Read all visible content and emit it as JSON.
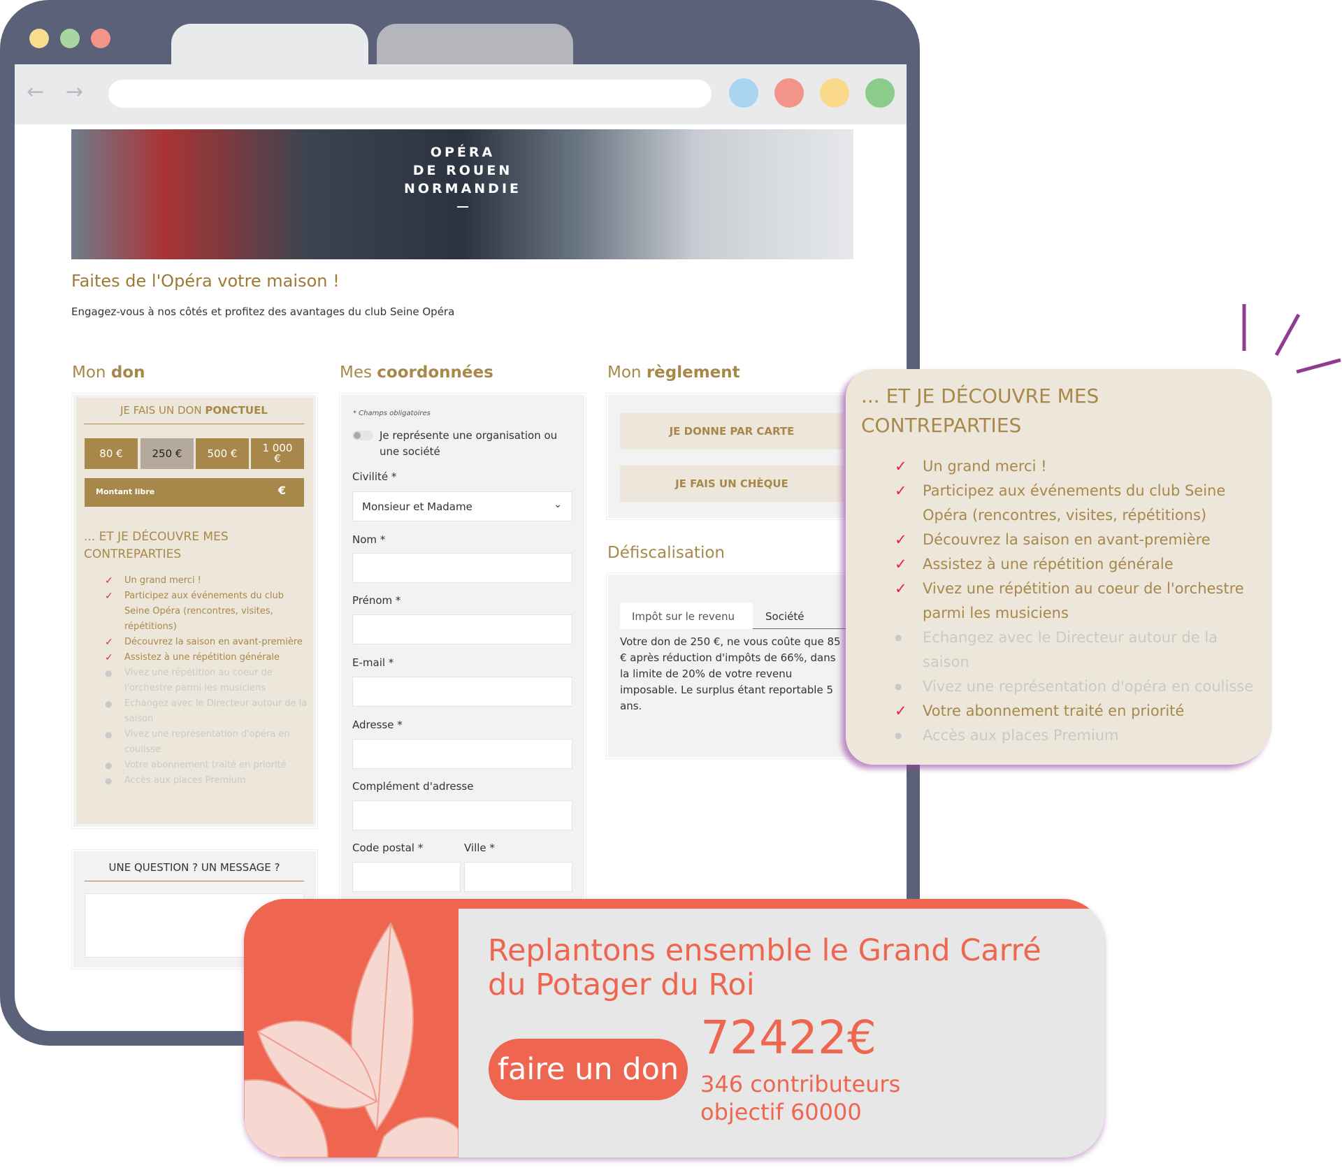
{
  "browser": {
    "back_icon": "arrow-left",
    "forward_icon": "arrow-right",
    "dots_colors": [
      "#a9d4f2",
      "#f2948a",
      "#fad98a",
      "#8ccc8a"
    ],
    "lights_colors": [
      "#f9dc8e",
      "#a7d6a1",
      "#f29488"
    ]
  },
  "banner": {
    "logo_lines": [
      "OPÉRA",
      "DE ROUEN",
      "NORMANDIE"
    ]
  },
  "page": {
    "title": "Faites de l'Opéra votre maison !",
    "subtitle": "Engagez-vous à nos côtés et profitez des avantages du club Seine Opéra"
  },
  "don": {
    "heading_light": "Mon",
    "heading_bold": "don",
    "panel_title_light": "JE FAIS UN DON",
    "panel_title_bold": "PONCTUEL",
    "amounts": [
      "80 €",
      "250 €",
      "500 €",
      "1 000 €"
    ],
    "selected_amount": "250 €",
    "free_amount_placeholder": "Montant libre",
    "free_amount_unit": "€",
    "benefits_title": "... ET JE DÉCOUVRE MES CONTREPARTIES",
    "benefits": [
      {
        "text": "Un grand merci !",
        "included": true
      },
      {
        "text": "Participez aux événements du club Seine Opéra (rencontres, visites, répétitions)",
        "included": true
      },
      {
        "text": "Découvrez la saison en avant-première",
        "included": true
      },
      {
        "text": "Assistez à une répétition générale",
        "included": true
      },
      {
        "text": "Vivez une répétition au coeur de l'orchestre parmi les musiciens",
        "included": false
      },
      {
        "text": "Echangez avec le Directeur autour de la saison",
        "included": false
      },
      {
        "text": "Vivez une représentation d'opéra en coulisse",
        "included": false
      },
      {
        "text": "Votre abonnement traité en priorité",
        "included": false
      },
      {
        "text": "Accès aux places Premium",
        "included": false
      }
    ]
  },
  "question": {
    "title": "UNE QUESTION ? UN MESSAGE ?",
    "value": ""
  },
  "coord": {
    "heading_light": "Mes",
    "heading_bold": "coordonnées",
    "required_note": "* Champs obligatoires",
    "org_toggle_label": "Je représente une organisation ou une société",
    "civilite_label": "Civilité *",
    "civilite_value": "Monsieur et Madame",
    "nom_label": "Nom *",
    "prenom_label": "Prénom *",
    "email_label": "E-mail *",
    "adresse_label": "Adresse *",
    "complement_label": "Complément d'adresse",
    "cp_label": "Code postal *",
    "ville_label": "Ville *"
  },
  "reglement": {
    "heading_light": "Mon",
    "heading_bold": "règlement",
    "card_button": "JE DONNE PAR CARTE",
    "cheque_button": "JE FAIS UN CHÈQUE"
  },
  "defisc": {
    "heading": "Défiscalisation",
    "tabs": [
      "Impôt sur le revenu",
      "Société"
    ],
    "active_tab": "Impôt sur le revenu",
    "text": "Votre don de 250 €, ne vous coûte que 85 € après réduction d'impôts de 66%, dans la limite de 20% de votre revenu imposable. Le surplus étant reportable 5 ans."
  },
  "popup": {
    "title": "... ET JE DÉCOUVRE MES CONTREPARTIES",
    "benefits": [
      {
        "text": "Un grand merci !",
        "included": true
      },
      {
        "text": "Participez aux événements du club Seine Opéra (rencontres, visites, répétitions)",
        "included": true
      },
      {
        "text": "Découvrez la saison en avant-première",
        "included": true
      },
      {
        "text": "Assistez à une répétition générale",
        "included": true
      },
      {
        "text": "Vivez une répétition au coeur de l'orchestre parmi les musiciens",
        "included": true
      },
      {
        "text": "Echangez avec le Directeur autour de la saison",
        "included": false
      },
      {
        "text": "Vivez une représentation d'opéra en coulisse",
        "included": false
      },
      {
        "text": "Votre abonnement traité en priorité",
        "included": true
      },
      {
        "text": "Accès aux places Premium",
        "included": false
      }
    ]
  },
  "campaign": {
    "title": "Replantons ensemble le Grand Carré du Potager du Roi",
    "button": "faire un don",
    "amount": "72422€",
    "contributors": "346 contributeurs",
    "goal": "objectif 60000",
    "accent": "#ee6650"
  }
}
